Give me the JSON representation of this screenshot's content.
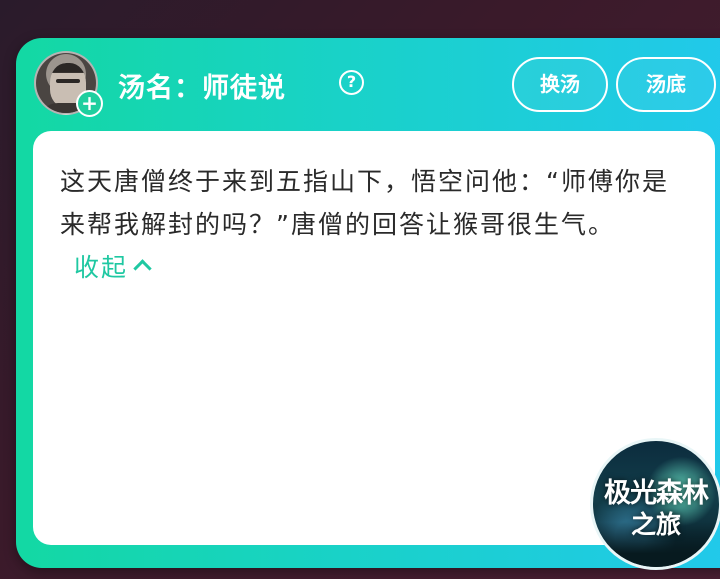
{
  "header": {
    "title": "汤名：师徒说",
    "help_icon": "question-circle-icon",
    "add_icon": "plus-icon",
    "buttons": {
      "change": "换汤",
      "answer": "汤底"
    }
  },
  "story": {
    "text": "这天唐僧终于来到五指山下，悟空问他：“师傅你是来帮我解封的吗？”唐僧的回答让猴哥很生气。",
    "collapse_label": "收起",
    "collapse_icon": "chevron-up-icon"
  },
  "logo": {
    "line1": "极光森林",
    "line2": "之旅"
  },
  "colors": {
    "accent_start": "#13d8a3",
    "accent_end": "#22c8ec",
    "collapse_link": "#1fc8a2",
    "panel_bg": "#ffffff"
  }
}
